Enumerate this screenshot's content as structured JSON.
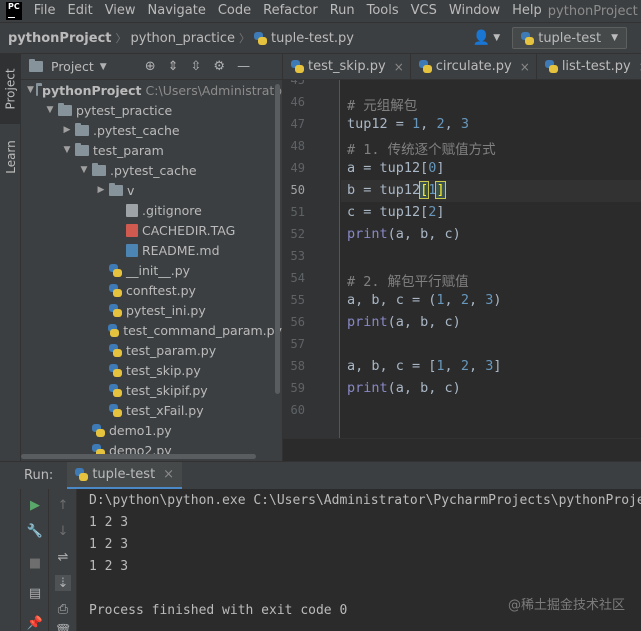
{
  "menubar": {
    "logo": "PC",
    "items": [
      "File",
      "Edit",
      "View",
      "Navigate",
      "Code",
      "Refactor",
      "Run",
      "Tools",
      "VCS",
      "Window",
      "Help"
    ],
    "project_name": "pythonProject"
  },
  "breadcrumb": {
    "items": [
      "pythonProject",
      "python_practice",
      "tuple-test.py"
    ]
  },
  "toolbar": {
    "run_config": "tuple-test"
  },
  "left_strip": {
    "project_tab": "Project",
    "learn_tab": "Learn"
  },
  "project_panel": {
    "title": "Project",
    "tree": [
      {
        "label": "pythonProject",
        "hint": "C:\\Users\\Administrato",
        "depth": 0,
        "kind": "folder",
        "expanded": true
      },
      {
        "label": "pytest_practice",
        "depth": 1,
        "kind": "folder",
        "expanded": true
      },
      {
        "label": ".pytest_cache",
        "depth": 2,
        "kind": "folder",
        "expanded": false
      },
      {
        "label": "test_param",
        "depth": 2,
        "kind": "folder",
        "expanded": true
      },
      {
        "label": ".pytest_cache",
        "depth": 3,
        "kind": "folder",
        "expanded": true
      },
      {
        "label": "v",
        "depth": 4,
        "kind": "folder",
        "expanded": false
      },
      {
        "label": ".gitignore",
        "depth": 5,
        "kind": "file"
      },
      {
        "label": "CACHEDIR.TAG",
        "depth": 5,
        "kind": "tag"
      },
      {
        "label": "README.md",
        "depth": 5,
        "kind": "md"
      },
      {
        "label": "__init__.py",
        "depth": 4,
        "kind": "py"
      },
      {
        "label": "conftest.py",
        "depth": 4,
        "kind": "py"
      },
      {
        "label": "pytest_ini.py",
        "depth": 4,
        "kind": "py"
      },
      {
        "label": "test_command_param.py",
        "depth": 4,
        "kind": "py"
      },
      {
        "label": "test_param.py",
        "depth": 4,
        "kind": "py"
      },
      {
        "label": "test_skip.py",
        "depth": 4,
        "kind": "py"
      },
      {
        "label": "test_skipif.py",
        "depth": 4,
        "kind": "py"
      },
      {
        "label": "test_xFail.py",
        "depth": 4,
        "kind": "py"
      },
      {
        "label": "demo1.py",
        "depth": 3,
        "kind": "py"
      },
      {
        "label": "demo2.py",
        "depth": 3,
        "kind": "py"
      }
    ]
  },
  "editor_tabs": [
    "test_skip.py",
    "circulate.py",
    "list-test.py"
  ],
  "editor": {
    "lines": [
      {
        "n": "45",
        "code": ""
      },
      {
        "n": "46",
        "code": "# 元组解包"
      },
      {
        "n": "47",
        "code": "tup12 = 1, 2, 3"
      },
      {
        "n": "48",
        "code": "# 1. 传统逐个赋值方式"
      },
      {
        "n": "49",
        "code": "a = tup12[0]"
      },
      {
        "n": "50",
        "code": "b = tup12[1]"
      },
      {
        "n": "51",
        "code": "c = tup12[2]"
      },
      {
        "n": "52",
        "code": "print(a, b, c)"
      },
      {
        "n": "53",
        "code": ""
      },
      {
        "n": "54",
        "code": "# 2. 解包平行赋值"
      },
      {
        "n": "55",
        "code": "a, b, c = (1, 2, 3)"
      },
      {
        "n": "56",
        "code": "print(a, b, c)"
      },
      {
        "n": "57",
        "code": ""
      },
      {
        "n": "58",
        "code": "a, b, c = [1, 2, 3]"
      },
      {
        "n": "59",
        "code": "print(a, b, c)"
      },
      {
        "n": "60",
        "code": ""
      }
    ],
    "current_line": "50"
  },
  "run_panel": {
    "label": "Run:",
    "tab": "tuple-test",
    "console": [
      "D:\\python\\python.exe C:\\Users\\Administrator\\PycharmProjects\\pythonProject\\python_practice\\tuple-test.py",
      "1 2 3",
      "1 2 3",
      "1 2 3",
      "",
      "Process finished with exit code 0"
    ]
  },
  "watermark": "@稀土掘金技术社区",
  "colors": {
    "background": "#2b2b2b",
    "panel": "#3c3f41",
    "accent": "#4a88c7",
    "comment": "#808080",
    "number": "#6897bb",
    "builtin": "#8888c6",
    "text": "#a9b7c6"
  }
}
